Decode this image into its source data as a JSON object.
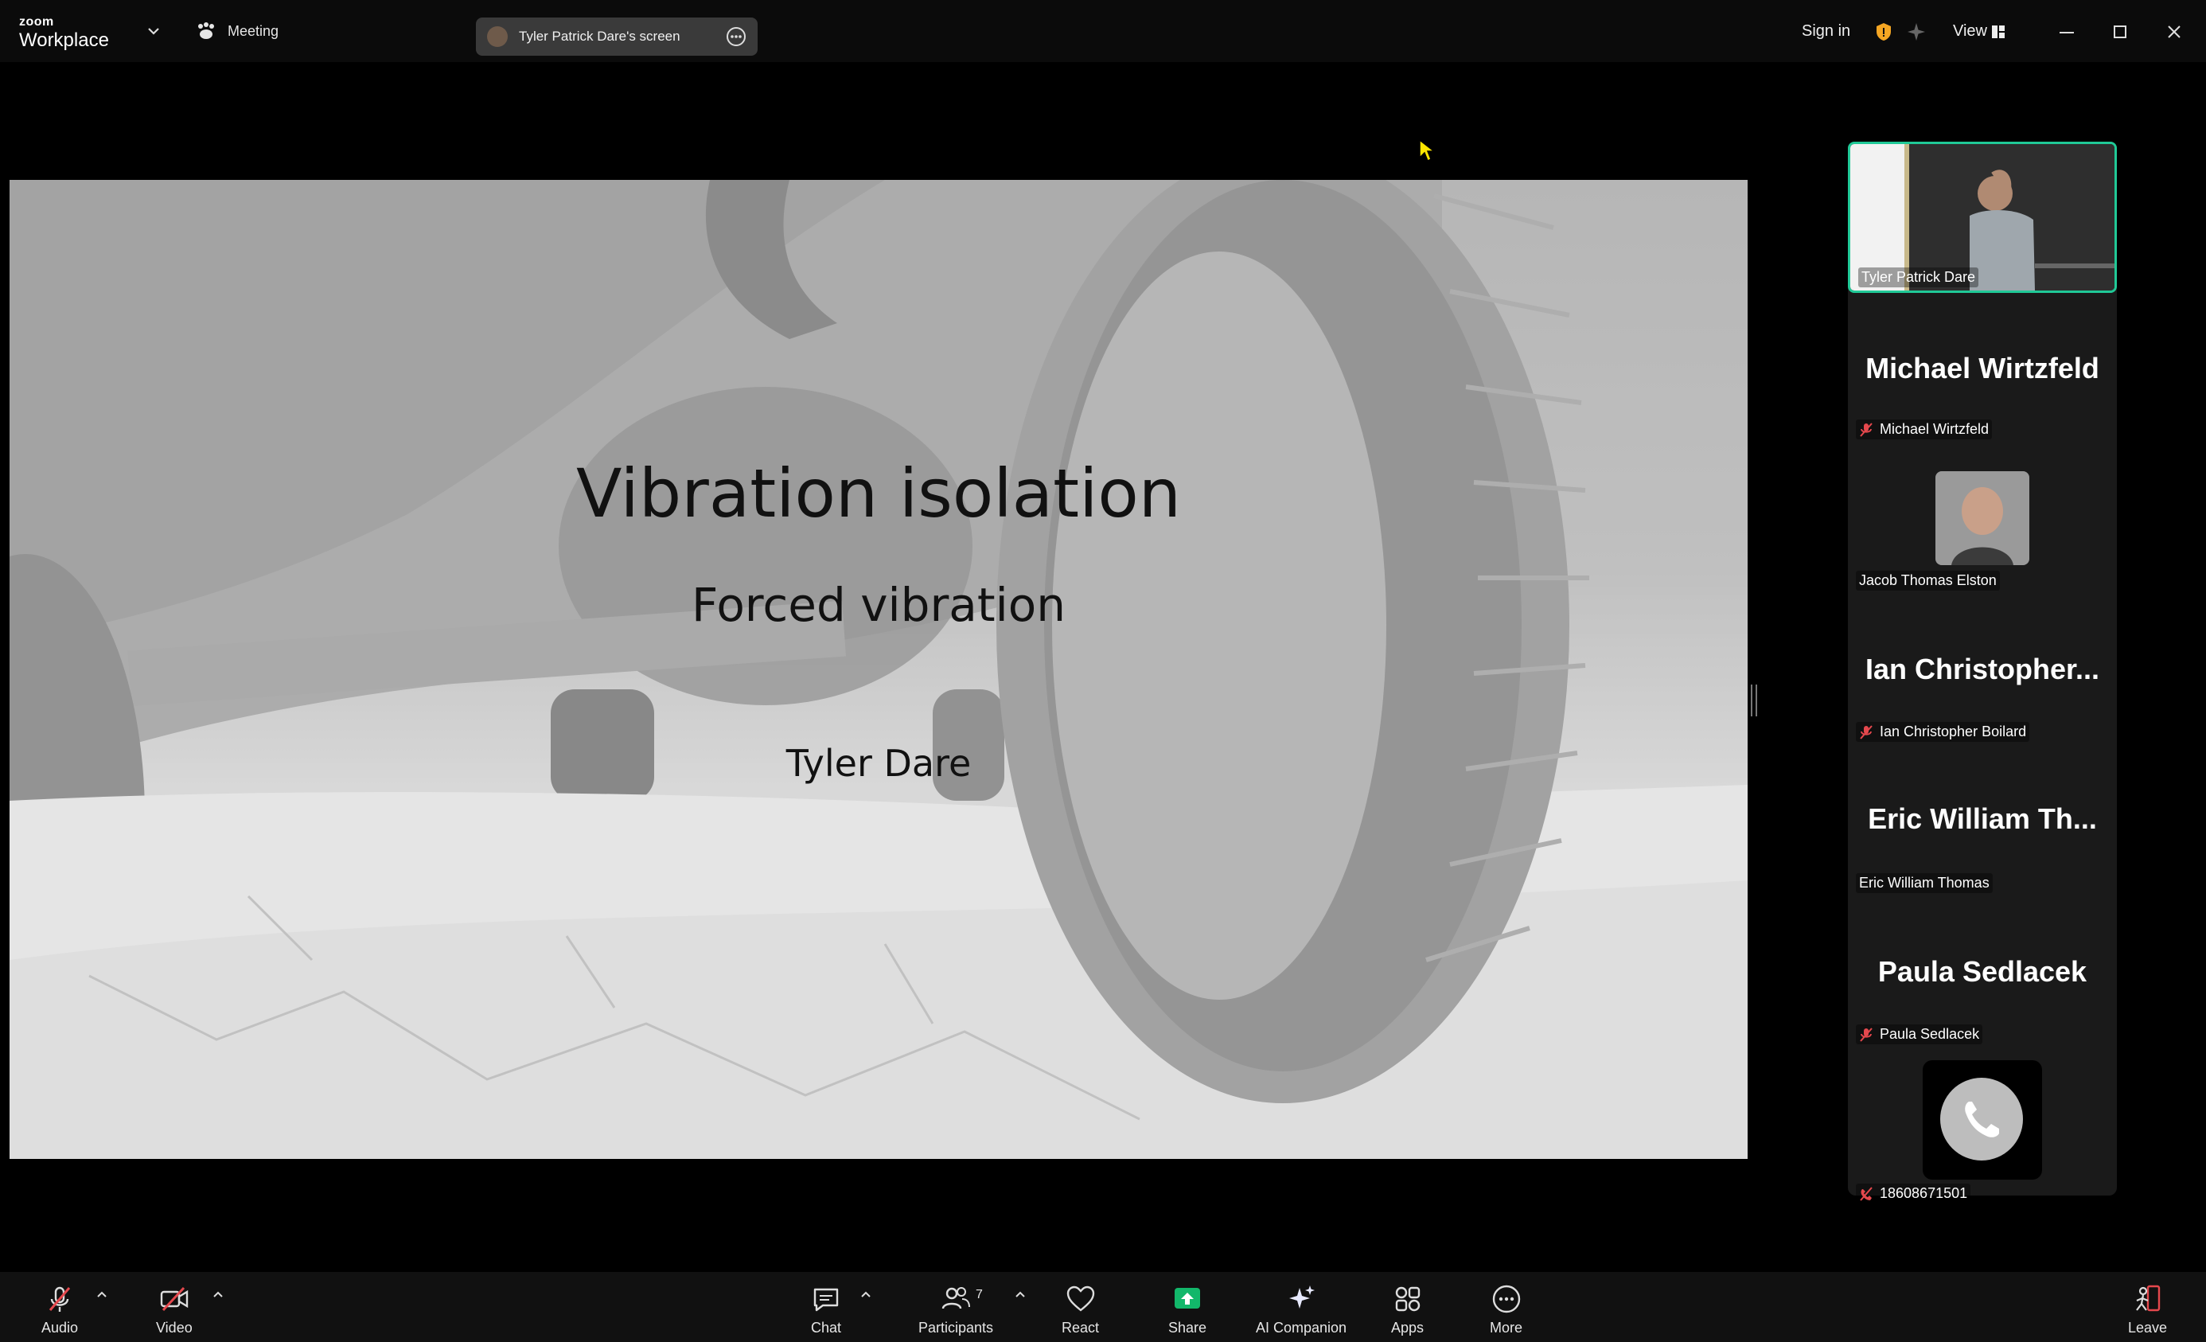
{
  "titlebar": {
    "logo_small": "zoom",
    "logo_big": "Workplace",
    "meeting_label": "Meeting",
    "share_label": "Tyler Patrick Dare's screen",
    "sign_in": "Sign in",
    "view_label": "View"
  },
  "slide": {
    "title": "Vibration isolation",
    "subtitle": "Forced vibration",
    "author": "Tyler Dare"
  },
  "gallery": {
    "self": {
      "name": "Tyler Patrick Dare"
    },
    "tiles": [
      {
        "display": "Michael Wirtzfeld",
        "name": "Michael Wirtzfeld",
        "muted": true
      },
      {
        "display": "",
        "name": "Jacob Thomas Elston",
        "muted": false
      },
      {
        "display": "Ian  Christopher...",
        "name": "Ian Christopher Boilard",
        "muted": true
      },
      {
        "display": "Eric William Th...",
        "name": "Eric William Thomas",
        "muted": false
      },
      {
        "display": "Paula Sedlacek",
        "name": "Paula Sedlacek",
        "muted": true
      },
      {
        "display": "",
        "name": "18608671501",
        "muted": true
      }
    ]
  },
  "toolbar": {
    "audio": "Audio",
    "video": "Video",
    "chat": "Chat",
    "participants": "Participants",
    "participants_count": "7",
    "react": "React",
    "share": "Share",
    "ai": "AI Companion",
    "apps": "Apps",
    "more": "More",
    "leave": "Leave"
  },
  "colors": {
    "accent_green": "#20c997",
    "share_green": "#12b76a",
    "mute_red": "#e5484d",
    "shield_orange": "#f5a623"
  }
}
